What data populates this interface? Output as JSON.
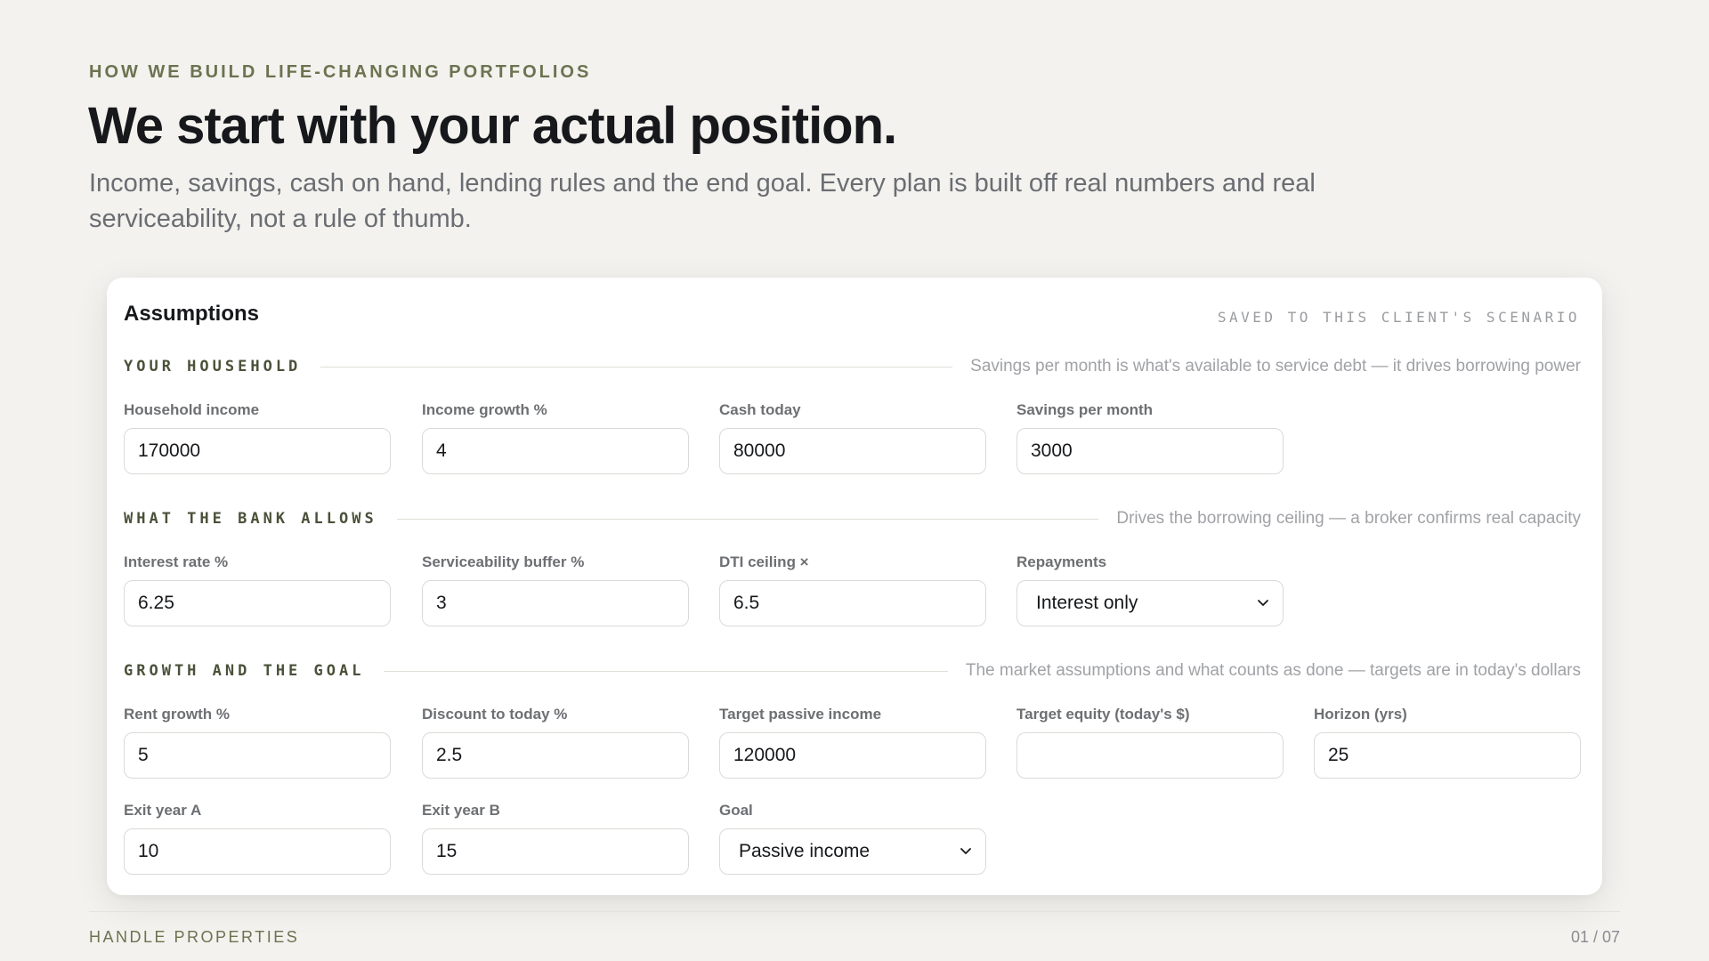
{
  "eyebrow": "HOW WE BUILD LIFE-CHANGING PORTFOLIOS",
  "headline": "We start with your actual position.",
  "lede": "Income, savings, cash on hand, lending rules and the end goal. Every plan is built off real numbers and real serviceability, not a rule of thumb.",
  "card": {
    "title": "Assumptions",
    "status": "SAVED TO THIS CLIENT'S SCENARIO",
    "sections": {
      "household": {
        "title": "YOUR HOUSEHOLD",
        "note": "Savings per month is what's available to service debt — it drives borrowing power",
        "fields": {
          "household_income": {
            "label": "Household income",
            "value": "170000"
          },
          "income_growth": {
            "label": "Income growth %",
            "value": "4"
          },
          "cash_today": {
            "label": "Cash today",
            "value": "80000"
          },
          "savings_per_month": {
            "label": "Savings per month",
            "value": "3000"
          }
        }
      },
      "bank": {
        "title": "WHAT THE BANK ALLOWS",
        "note": "Drives the borrowing ceiling — a broker confirms real capacity",
        "fields": {
          "interest_rate": {
            "label": "Interest rate %",
            "value": "6.25"
          },
          "serviceability_buffer": {
            "label": "Serviceability buffer %",
            "value": "3"
          },
          "dti_ceiling": {
            "label": "DTI ceiling ×",
            "value": "6.5"
          },
          "repayments": {
            "label": "Repayments",
            "value": "Interest only"
          }
        }
      },
      "growth": {
        "title": "GROWTH AND THE GOAL",
        "note": "The market assumptions and what counts as done — targets are in today's dollars",
        "fields": {
          "rent_growth": {
            "label": "Rent growth %",
            "value": "5"
          },
          "discount_to_today": {
            "label": "Discount to today %",
            "value": "2.5"
          },
          "target_passive_income": {
            "label": "Target passive income",
            "value": "120000"
          },
          "target_equity": {
            "label": "Target equity (today's $)",
            "value": ""
          },
          "horizon": {
            "label": "Horizon (yrs)",
            "value": "25"
          },
          "exit_year_a": {
            "label": "Exit year A",
            "value": "10"
          },
          "exit_year_b": {
            "label": "Exit year B",
            "value": "15"
          },
          "goal": {
            "label": "Goal",
            "value": "Passive income"
          }
        }
      }
    }
  },
  "footer": {
    "brand": "HANDLE PROPERTIES",
    "page": "01 / 07"
  }
}
